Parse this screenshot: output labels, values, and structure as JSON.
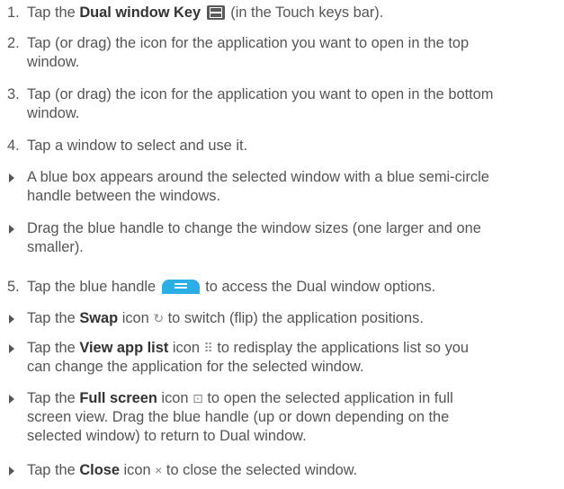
{
  "steps": [
    {
      "num": "1.",
      "before": "Tap the ",
      "bold": "Dual window Key",
      "after": " (in the Touch keys bar).",
      "icon": "dual-window-key-icon"
    },
    {
      "num": "2.",
      "line1": "Tap (or drag) the icon for the application you want to open in the top",
      "line2": "window."
    },
    {
      "num": "3.",
      "line1": "Tap (or drag) the icon for the application you want to open in the bottom",
      "line2": "window."
    },
    {
      "num": "4.",
      "line1": "Tap a window to select and use it."
    }
  ],
  "bullets_a": [
    {
      "line1": "A blue box appears around the selected window with a blue semi-circle",
      "line2": "handle between the windows."
    },
    {
      "line1": "Drag the blue handle to change the window sizes (one larger and one",
      "line2": "smaller)."
    }
  ],
  "step5": {
    "num": "5.",
    "before": "Tap the blue handle",
    "after": "to access the Dual window options.",
    "icon": "blue-handle-icon"
  },
  "bullets_b": [
    {
      "before": "Tap the ",
      "bold": "Swap",
      "mid": " icon",
      "after": "to switch (flip) the application positions.",
      "icon": "swap-icon",
      "glyph": "↻"
    },
    {
      "before": "Tap the ",
      "bold": "View app list",
      "mid": " icon",
      "after": "to redisplay the applications list so you",
      "line2": "can change the application for the selected window.",
      "icon": "grid-icon",
      "glyph": "⠿"
    },
    {
      "before": "Tap the ",
      "bold": "Full screen",
      "mid": " icon",
      "after": "to open the selected application in full",
      "line2": "screen view. Drag the blue handle (up or down depending on the",
      "line3": "selected window) to return to Dual window.",
      "icon": "full-screen-icon",
      "glyph": "⊡"
    },
    {
      "before": "Tap the ",
      "bold": "Close",
      "mid": " icon",
      "after": "to close the selected window.",
      "icon": "close-icon",
      "glyph": "×"
    }
  ]
}
